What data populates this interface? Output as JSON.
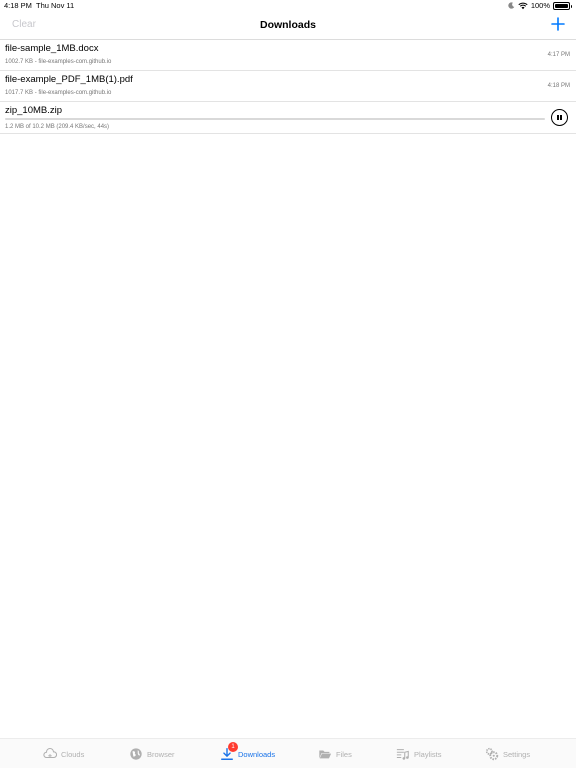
{
  "status_bar": {
    "time": "4:18 PM",
    "date": "Thu Nov 11",
    "battery": "100%"
  },
  "nav": {
    "clear_label": "Clear",
    "title": "Downloads",
    "add_icon": "plus-icon"
  },
  "downloads": [
    {
      "name": "file-sample_1MB.docx",
      "detail": "1002.7 KB - file-examples-com.github.io",
      "time": "4:17 PM"
    },
    {
      "name": "file-example_PDF_1MB(1).pdf",
      "detail": "1017.7 KB - file-examples-com.github.io",
      "time": "4:18 PM"
    }
  ],
  "active_download": {
    "name": "zip_10MB.zip",
    "detail": "1.2 MB of 10.2 MB (209.4 KB/sec,  44s)",
    "progress_fraction": 0.0,
    "icon": "pause-icon"
  },
  "tabs": [
    {
      "label": "Clouds",
      "icon": "cloud-icon",
      "active": false
    },
    {
      "label": "Browser",
      "icon": "globe-icon",
      "active": false
    },
    {
      "label": "Downloads",
      "icon": "download-icon",
      "active": true,
      "badge": "1"
    },
    {
      "label": "Files",
      "icon": "folder-icon",
      "active": false
    },
    {
      "label": "Playlists",
      "icon": "playlist-icon",
      "active": false
    },
    {
      "label": "Settings",
      "icon": "gear-icon",
      "active": false
    }
  ],
  "colors": {
    "accent": "#1a73e8",
    "inactive_tab": "#b0b0b0",
    "badge": "#ff3b30"
  }
}
